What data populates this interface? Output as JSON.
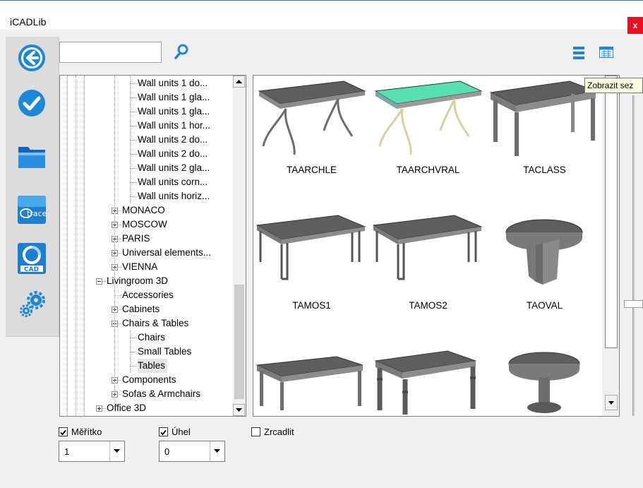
{
  "window": {
    "title": "iCADLib",
    "close_label": "x"
  },
  "search": {
    "value": "",
    "placeholder": ""
  },
  "tooltip": "Zobrazit sez",
  "tree": {
    "items": [
      {
        "label": "Wall units 1 do...",
        "level": 4
      },
      {
        "label": "Wall units 1 gla...",
        "level": 4
      },
      {
        "label": "Wall units 1 gla...",
        "level": 4
      },
      {
        "label": "Wall units 1 hor...",
        "level": 4
      },
      {
        "label": "Wall units 2 do...",
        "level": 4
      },
      {
        "label": "Wall units 2 do...",
        "level": 4
      },
      {
        "label": "Wall units 2 gla...",
        "level": 4
      },
      {
        "label": "Wall units corn...",
        "level": 4
      },
      {
        "label": "Wall units horiz...",
        "level": 4
      },
      {
        "label": "MONACO",
        "level": 3,
        "expander": "plus"
      },
      {
        "label": "MOSCOW",
        "level": 3,
        "expander": "plus"
      },
      {
        "label": "PARIS",
        "level": 3,
        "expander": "plus"
      },
      {
        "label": "Universal elements...",
        "level": 3,
        "expander": "plus"
      },
      {
        "label": "VIENNA",
        "level": 3,
        "expander": "plus"
      },
      {
        "label": "Livingroom 3D",
        "level": 2,
        "expander": "minus"
      },
      {
        "label": "Accessories",
        "level": 3
      },
      {
        "label": "Cabinets",
        "level": 3,
        "expander": "plus"
      },
      {
        "label": "Chairs & Tables",
        "level": 3,
        "expander": "minus"
      },
      {
        "label": "Chairs",
        "level": 4
      },
      {
        "label": "Small Tables",
        "level": 4
      },
      {
        "label": "Tables",
        "level": 4,
        "selected": true
      },
      {
        "label": "Components",
        "level": 3,
        "expander": "plus"
      },
      {
        "label": "Sofas & Armchairs",
        "level": 3,
        "expander": "plus"
      },
      {
        "label": "Office 3D",
        "level": 2,
        "expander": "plus"
      }
    ]
  },
  "gallery": {
    "items": [
      {
        "label": "TAARCHLE",
        "kind": "archle",
        "highlight": false
      },
      {
        "label": "TAARCHVRAL",
        "kind": "archle",
        "highlight": true
      },
      {
        "label": "TACLASS",
        "kind": "class",
        "highlight": false
      },
      {
        "label": "TAMOS1",
        "kind": "mos",
        "highlight": false
      },
      {
        "label": "TAMOS2",
        "kind": "mos",
        "highlight": false
      },
      {
        "label": "TAOVAL",
        "kind": "oval",
        "highlight": false
      },
      {
        "label": "",
        "kind": "plain",
        "highlight": false
      },
      {
        "label": "",
        "kind": "turned",
        "highlight": false
      },
      {
        "label": "",
        "kind": "round",
        "highlight": false
      }
    ]
  },
  "options": {
    "scale": {
      "label": "Měřítko",
      "checked": true,
      "value": "1"
    },
    "angle": {
      "label": "Úhel",
      "checked": true,
      "value": "0"
    },
    "mirror": {
      "label": "Zrcadlit",
      "checked": false
    }
  },
  "colors": {
    "accent": "#1e88d8",
    "close": "#e81123",
    "table_top": "#5e5e5e",
    "table_side": "#8c8c8c",
    "highlight_top": "#59e0b0"
  },
  "icons": [
    "back-arrow-icon",
    "check-icon",
    "folder-icon",
    "trace-icon",
    "cad-icon",
    "gears-icon",
    "search-icon",
    "list-view-icon",
    "grid-view-icon"
  ]
}
